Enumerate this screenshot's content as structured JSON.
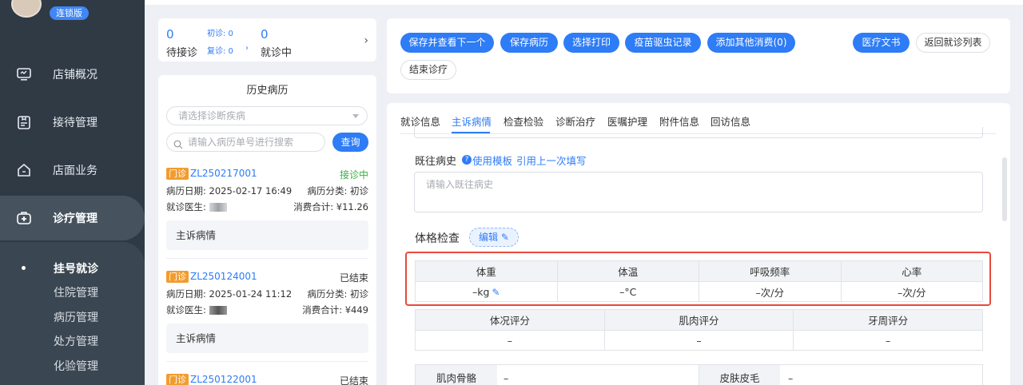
{
  "sidebar": {
    "edition_badge": "连锁版",
    "nav": [
      {
        "label": "店铺概况",
        "icon": "monitor-icon"
      },
      {
        "label": "接待管理",
        "icon": "clipboard-icon"
      },
      {
        "label": "店面业务",
        "icon": "house-icon"
      },
      {
        "label": "诊疗管理",
        "icon": "medical-kit-icon"
      }
    ],
    "submenu": [
      "挂号就诊",
      "住院管理",
      "病历管理",
      "处方管理",
      "化验管理"
    ]
  },
  "stats": {
    "waiting_count": "0",
    "waiting_label": "待接诊",
    "first_visit": "初诊: 0",
    "revisit": "复诊: 0",
    "in_progress_count": "0",
    "in_progress_label": "就诊中"
  },
  "history": {
    "title": "历史病历",
    "select_placeholder": "请选择诊断疾病",
    "search_placeholder": "请输入病历单号进行搜索",
    "query_button": "查询",
    "records": [
      {
        "tag": "门诊",
        "id": "ZL250217001",
        "status": "接诊中",
        "date": "病历日期: 2025-02-17 16:49",
        "category": "病历分类: 初诊",
        "doctor": "就诊医生:",
        "total": "消费合计: ¥11.26",
        "sub": "主诉病情"
      },
      {
        "tag": "门诊",
        "id": "ZL250124001",
        "status": "已结束",
        "date": "病历日期: 2025-01-24 11:12",
        "category": "病历分类: 初诊",
        "doctor": "就诊医生:",
        "total": "消费合计: ¥449",
        "sub": "主诉病情"
      },
      {
        "tag": "门诊",
        "id": "ZL250122001",
        "status": "已结束"
      }
    ]
  },
  "actions": {
    "save_view_next": "保存并查看下一个",
    "save_record": "保存病历",
    "select_print": "选择打印",
    "vaccine_record": "疫苗驱虫记录",
    "add_other_fee": "添加其他消费(0)",
    "medical_docs": "医疗文书",
    "back_to_list": "返回就诊列表",
    "end_visit": "结束诊疗"
  },
  "tabs": [
    "就诊信息",
    "主诉病情",
    "检查检验",
    "诊断治疗",
    "医嘱护理",
    "附件信息",
    "回访信息"
  ],
  "past_history": {
    "label": "既往病史",
    "use_template": "使用模板",
    "quote_last": "引用上一次填写",
    "placeholder": "请输入既往病史"
  },
  "physical_exam": {
    "label": "体格检查",
    "edit_button": "编辑",
    "vitals_headers": [
      "体重",
      "体温",
      "呼吸频率",
      "心率"
    ],
    "vitals_values": [
      "–kg",
      "–°C",
      "–次/分",
      "–次/分"
    ],
    "score_headers": [
      "体况评分",
      "肌肉评分",
      "牙周评分"
    ],
    "score_values": [
      "–",
      "–",
      "–"
    ],
    "kv": [
      {
        "label": "肌肉骨骼",
        "value": "–"
      },
      {
        "label": "皮肤皮毛",
        "value": "–"
      }
    ]
  }
}
